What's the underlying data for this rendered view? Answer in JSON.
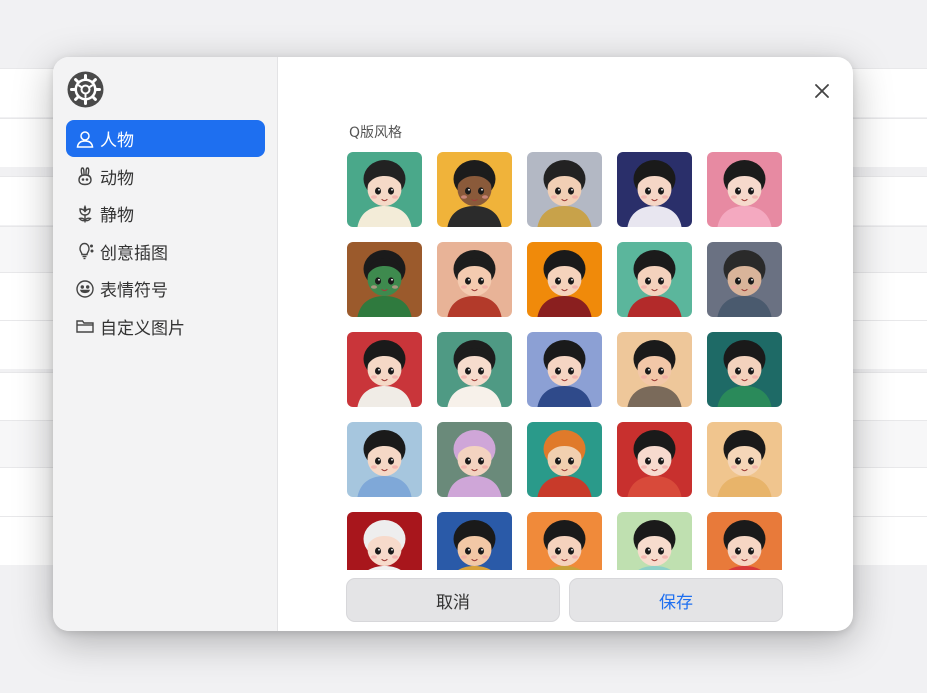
{
  "sidebar": {
    "items": [
      {
        "label": "人物",
        "icon": "person-icon",
        "active": true
      },
      {
        "label": "动物",
        "icon": "rabbit-icon",
        "active": false
      },
      {
        "label": "静物",
        "icon": "flower-icon",
        "active": false
      },
      {
        "label": "创意插图",
        "icon": "bulb-icon",
        "active": false
      },
      {
        "label": "表情符号",
        "icon": "smiley-icon",
        "active": false
      },
      {
        "label": "自定义图片",
        "icon": "folder-icon",
        "active": false
      }
    ]
  },
  "main": {
    "section_title": "Q版风格",
    "avatars": [
      {
        "bg": "#4aa88a",
        "skin": "#f5d9c7",
        "hair": "#222222",
        "outfit": "#f3ecd8"
      },
      {
        "bg": "#f0b33a",
        "skin": "#8a5a3a",
        "hair": "#1c1c1c",
        "outfit": "#2b2b2b"
      },
      {
        "bg": "#b3b8c4",
        "skin": "#f1cfb5",
        "hair": "#222222",
        "outfit": "#c8a24a"
      },
      {
        "bg": "#2a2f6a",
        "skin": "#f5d6c6",
        "hair": "#1a1a1a",
        "outfit": "#e8e6f0"
      },
      {
        "bg": "#e78aa2",
        "skin": "#f6d9cc",
        "hair": "#1b1b1b",
        "outfit": "#f4a9c0"
      },
      {
        "bg": "#9b5a2c",
        "skin": "#3e8a4e",
        "hair": "#1b1b1b",
        "outfit": "#2f7a3e"
      },
      {
        "bg": "#e8b397",
        "skin": "#f4cbb0",
        "hair": "#1d1d1d",
        "outfit": "#b33a2a"
      },
      {
        "bg": "#f08a0a",
        "skin": "#f5d3bc",
        "hair": "#1a1a1a",
        "outfit": "#8a1f1f"
      },
      {
        "bg": "#5bb69c",
        "skin": "#f4d2bd",
        "hair": "#1b1b1b",
        "outfit": "#b32a2a"
      },
      {
        "bg": "#6a7182",
        "skin": "#d9b49a",
        "hair": "#2a2a2a",
        "outfit": "#4a5a6e"
      },
      {
        "bg": "#c9353a",
        "skin": "#f5d8c6",
        "hair": "#1a1a1a",
        "outfit": "#f0ece6"
      },
      {
        "bg": "#4f9a84",
        "skin": "#f6dccd",
        "hair": "#1d1d1d",
        "outfit": "#f7f1ea"
      },
      {
        "bg": "#8ca0d4",
        "skin": "#f5d5c3",
        "hair": "#1a1a1a",
        "outfit": "#2f4a8a"
      },
      {
        "bg": "#eec79a",
        "skin": "#f2c7a8",
        "hair": "#1a1a1a",
        "outfit": "#7a6a5a"
      },
      {
        "bg": "#1e6a66",
        "skin": "#f3d2bd",
        "hair": "#1a1a1a",
        "outfit": "#2a8a5a"
      },
      {
        "bg": "#a6c6de",
        "skin": "#f5d8c6",
        "hair": "#1a1a1a",
        "outfit": "#7fa8d8"
      },
      {
        "bg": "#6a8a7a",
        "skin": "#f3d3c0",
        "hair": "#cfa6d8",
        "outfit": "#cfa6d8"
      },
      {
        "bg": "#2a9a8a",
        "skin": "#f1d0b0",
        "hair": "#e07a2a",
        "outfit": "#c83a2a"
      },
      {
        "bg": "#c8302e",
        "skin": "#f7dace",
        "hair": "#1a1a1a",
        "outfit": "#d84a3a"
      },
      {
        "bg": "#f0c58e",
        "skin": "#f5d6b8",
        "hair": "#1a1a1a",
        "outfit": "#e8b46a"
      },
      {
        "bg": "#a8161c",
        "skin": "#f7dacb",
        "hair": "#eeeeee",
        "outfit": "#f0f0f0"
      },
      {
        "bg": "#2a5aa8",
        "skin": "#f2c8a6",
        "hair": "#1a1a1a",
        "outfit": "#d8a23a"
      },
      {
        "bg": "#f08a3a",
        "skin": "#f5d2bd",
        "hair": "#1a1a1a",
        "outfit": "#c8a23a"
      },
      {
        "bg": "#bfe0b0",
        "skin": "#f7dccd",
        "hair": "#1a1a1a",
        "outfit": "#8ed0c8"
      },
      {
        "bg": "#e87a3a",
        "skin": "#f6d6c4",
        "hair": "#1a1a1a",
        "outfit": "#d83a3a"
      }
    ]
  },
  "footer": {
    "cancel_label": "取消",
    "save_label": "保存"
  },
  "colors": {
    "accent": "#1e6ff0"
  }
}
